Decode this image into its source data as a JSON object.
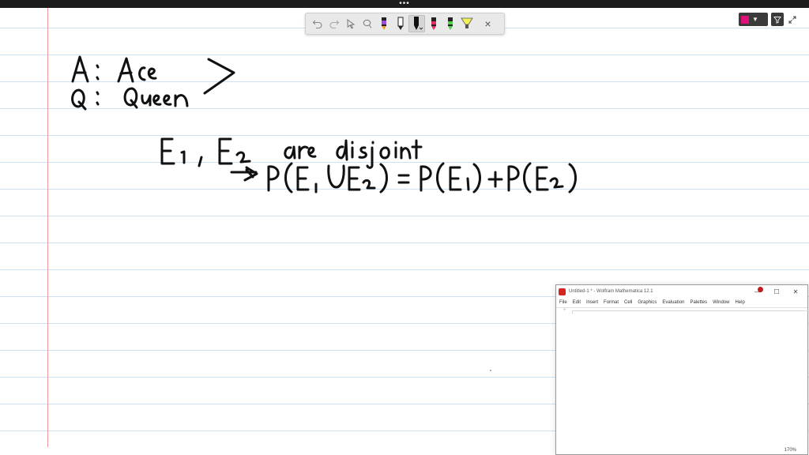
{
  "toolbar": {
    "tools": [
      {
        "icon": "undo-icon",
        "active": false
      },
      {
        "icon": "redo-icon",
        "active": false
      },
      {
        "icon": "select-pointer-icon",
        "active": false
      },
      {
        "icon": "lasso-icon",
        "active": false
      },
      {
        "icon": "pen-purple-icon",
        "active": false
      },
      {
        "icon": "pen-black-outline-icon",
        "active": false
      },
      {
        "icon": "pen-black-icon",
        "active": true
      },
      {
        "icon": "pen-red-icon",
        "active": false
      },
      {
        "icon": "pen-green-icon",
        "active": false
      },
      {
        "icon": "highlighter-yellow-icon",
        "active": false
      },
      {
        "icon": "close-icon",
        "active": false
      }
    ],
    "close_label": "×"
  },
  "colors": {
    "current_ink": "#e0107a",
    "margin": "#f29a9a",
    "rule": "#cfe2f3",
    "pen_purple": "#a04ad8",
    "pen_red": "#e03060",
    "pen_green": "#4fcf4f",
    "highlighter": "#f5f05a"
  },
  "mathematica": {
    "title": "Untitled-1 * - Wolfram Mathematica 12.1",
    "menus": [
      "File",
      "Edit",
      "Insert",
      "Format",
      "Cell",
      "Graphics",
      "Evaluation",
      "Palettes",
      "Window",
      "Help"
    ],
    "zoom": "170%",
    "window_controls": [
      "—",
      "☐",
      "✕"
    ],
    "cell_insert": "+"
  }
}
